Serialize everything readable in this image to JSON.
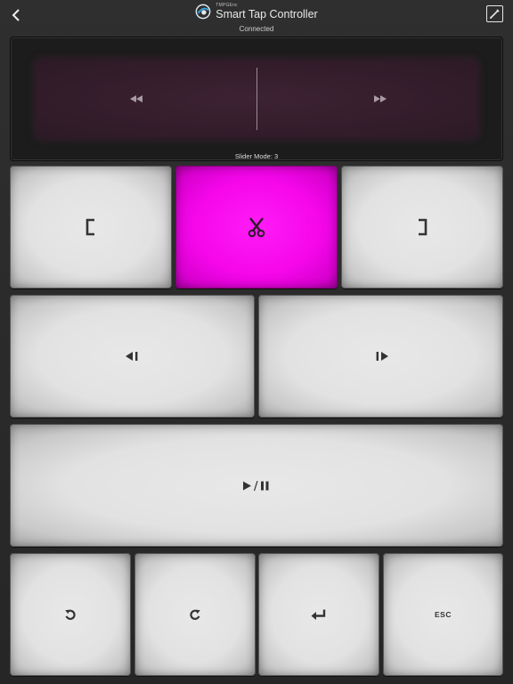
{
  "header": {
    "brand_small": "TMPGEnc",
    "title": "Smart Tap Controller",
    "status": "Connected"
  },
  "slider": {
    "mode_label": "Slider Mode: 3"
  },
  "keys": {
    "esc_label": "ESC"
  },
  "icons": {
    "back": "chevron-left-icon",
    "logo": "tmpgenc-logo-icon",
    "edit": "pencil-edit-icon",
    "rewind": "rewind-icon",
    "fast_forward": "fast-forward-icon",
    "mark_in": "mark-in-bracket-icon",
    "cut": "scissors-icon",
    "mark_out": "mark-out-bracket-icon",
    "prev_frame": "previous-frame-icon",
    "next_frame": "next-frame-icon",
    "play_pause": "play-pause-icon",
    "undo": "undo-icon",
    "redo": "redo-icon",
    "enter": "enter-icon"
  },
  "colors": {
    "accent": "#f507ea",
    "key": "#e2e2e2",
    "background": "#2a2a2a",
    "slider_track": "#361f2d"
  }
}
